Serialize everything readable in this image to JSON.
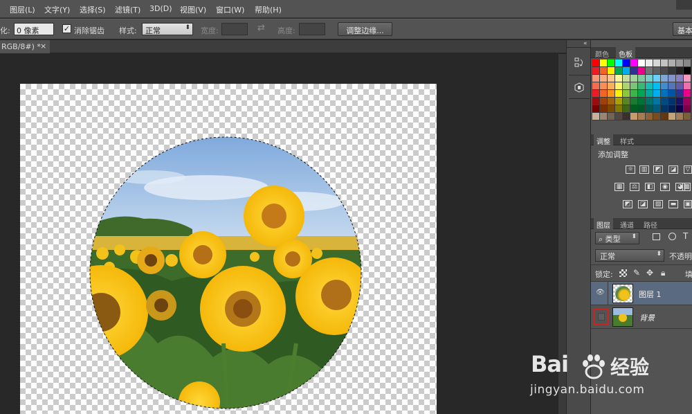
{
  "menu": [
    "图层(L)",
    "文字(Y)",
    "选择(S)",
    "滤镜(T)",
    "3D(D)",
    "视图(V)",
    "窗口(W)",
    "帮助(H)"
  ],
  "options": {
    "feather_label": "化:",
    "feather_value": "0 像素",
    "antialias_label": "消除锯齿",
    "antialias_checked": "✓",
    "style_label": "样式:",
    "style_value": "正常",
    "width_label": "宽度:",
    "height_label": "高度:",
    "refine_edge_button": "调整边缘...",
    "workspace_button": "基本"
  },
  "document": {
    "tab_title": "RGB/8#) *",
    "tab_close": "×"
  },
  "panel_collapse": "«",
  "color_panel": {
    "tabs": [
      "颜色",
      "色板"
    ],
    "swatch_rows": [
      [
        "#ff0000",
        "#ffff00",
        "#00ff00",
        "#00ffff",
        "#0000ff",
        "#ff00ff",
        "#ffffff",
        "#ebebeb",
        "#d7d7d7",
        "#c3c3c3",
        "#afafaf",
        "#9b9b9b",
        "#878787"
      ],
      [
        "#ed1c24",
        "#f26522",
        "#fff200",
        "#00a651",
        "#00aeef",
        "#2e3192",
        "#ec008c",
        "#737373",
        "#5f5f5f",
        "#4b4b4b",
        "#373737",
        "#232323",
        "#000000"
      ],
      [
        "#f7977a",
        "#fbad82",
        "#fdc68c",
        "#fff79a",
        "#c4df9b",
        "#a3d39c",
        "#82ca9d",
        "#7bcdc8",
        "#6ecff6",
        "#7ea7d8",
        "#8493ca",
        "#8882be",
        "#f49ac1"
      ],
      [
        "#f26c4f",
        "#f68e55",
        "#fbaf5a",
        "#fff467",
        "#acd372",
        "#7cc576",
        "#3bb878",
        "#1abbb4",
        "#00bff3",
        "#438ccb",
        "#5574b9",
        "#605ca8",
        "#f06eaa"
      ],
      [
        "#ed1c24",
        "#f26522",
        "#f7941d",
        "#fff200",
        "#8dc63f",
        "#39b54a",
        "#00a651",
        "#00a99d",
        "#00aeef",
        "#0072bc",
        "#0054a6",
        "#2e3192",
        "#ec008c"
      ],
      [
        "#9e0b0f",
        "#a0410d",
        "#a3620a",
        "#aba000",
        "#598527",
        "#197b30",
        "#007236",
        "#00746b",
        "#0076a3",
        "#004b80",
        "#003471",
        "#1b1464",
        "#9e005d"
      ],
      [
        "#790000",
        "#7b2e00",
        "#7d4900",
        "#827b00",
        "#406618",
        "#005e20",
        "#005826",
        "#005952",
        "#005b7f",
        "#003663",
        "#002157",
        "#0d004c",
        "#7b0046"
      ],
      [
        "#c7b299",
        "#998675",
        "#736357",
        "#534741",
        "#37302d",
        "#c69c6d",
        "#a67c52",
        "#8c6239",
        "#754c24",
        "#603913",
        "#c3a37c",
        "#9e7e5a",
        "#7a5f3d"
      ]
    ]
  },
  "adjust_panel": {
    "tabs": [
      "调整",
      "样式"
    ],
    "title": "添加调整",
    "icons": [
      "brightness-icon",
      "levels-icon",
      "curves-icon",
      "exposure-icon",
      "vibrance-icon",
      "hue-sat-icon",
      "color-balance-icon",
      "bw-icon",
      "photo-filter-icon",
      "channel-mixer-icon",
      "color-lookup-icon",
      "invert-icon",
      "posterize-icon",
      "threshold-icon",
      "gradient-map-icon",
      "selective-color-icon"
    ]
  },
  "layers_panel": {
    "tabs": [
      "图层",
      "通道",
      "路径"
    ],
    "filter_value": "类型",
    "blend_mode": "正常",
    "opacity_label": "不透明",
    "lock_label": "锁定:",
    "fill_label": "填",
    "layers": [
      {
        "name": "图层 1",
        "visible_icon": "👁",
        "selected": true
      },
      {
        "name": "背景",
        "visible_icon": "",
        "selected": false
      }
    ]
  },
  "watermark": {
    "brand_left": "Bai",
    "brand_right": "经验",
    "url": "jingyan.baidu.com"
  },
  "colors": {
    "app_bg": "#535353",
    "canvas_bg": "#282828",
    "selection_highlight": "#cc2222",
    "selected_layer": "#5a6a80"
  }
}
